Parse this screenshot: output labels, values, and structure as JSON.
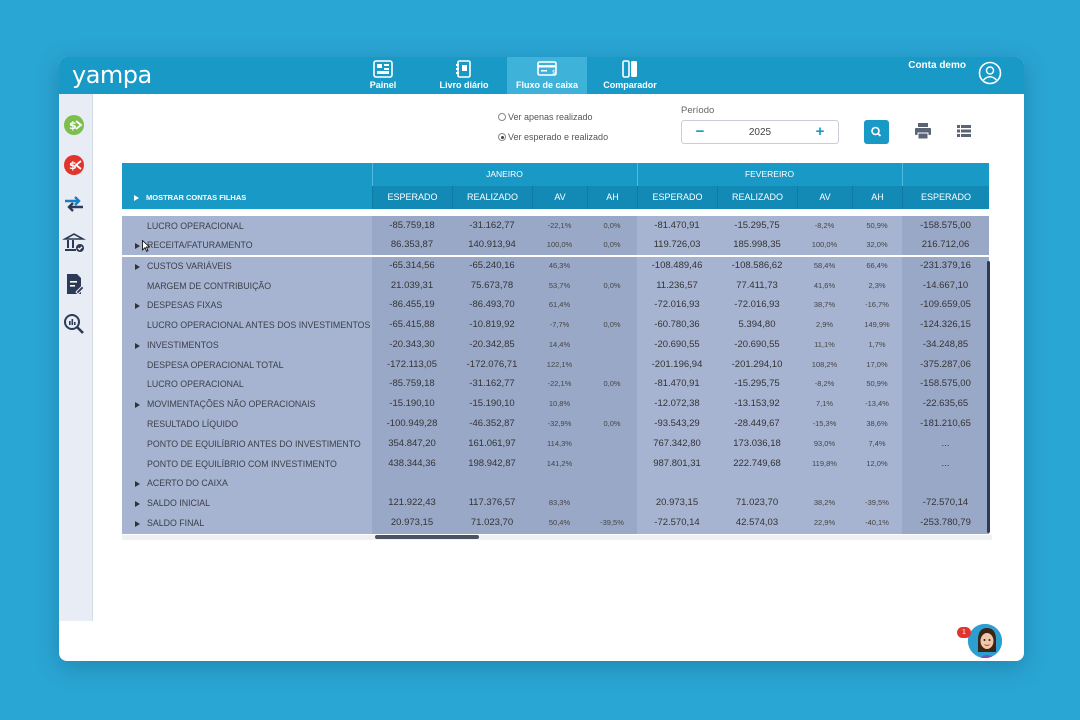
{
  "app": {
    "logo": "yampa",
    "account_label": "Conta demo"
  },
  "nav": {
    "items": [
      {
        "label": "Painel",
        "icon": "dashboard-icon"
      },
      {
        "label": "Livro diário",
        "icon": "journal-icon"
      },
      {
        "label": "Fluxo de caixa",
        "icon": "cashflow-icon",
        "active": true
      },
      {
        "label": "Comparador",
        "icon": "compare-icon"
      }
    ]
  },
  "sidebar": {
    "icons": [
      "income-icon",
      "expense-icon",
      "transfer-icon",
      "bank-check-icon",
      "report-edit-icon",
      "search-analytics-icon"
    ]
  },
  "filters": {
    "radio_realizado": "Ver apenas realizado",
    "radio_esperado": "Ver esperado e realizado",
    "selected": "esperado",
    "periodo_label": "Período",
    "year": "2025",
    "minus": "−",
    "plus": "+"
  },
  "table": {
    "months": [
      "JANEIRO",
      "FEVEREIRO"
    ],
    "show_children_label": "MOSTRAR CONTAS FILHAS",
    "columns": [
      "ESPERADO",
      "REALIZADO",
      "AV",
      "AH",
      "ESPERADO",
      "REALIZADO",
      "AV",
      "AH",
      "ESPERADO"
    ],
    "rows": [
      {
        "label": "LUCRO OPERACIONAL",
        "expand": false,
        "values": [
          "-85.759,18",
          "-31.162,77",
          "-22,1%",
          "0,0%",
          "-81.470,91",
          "-15.295,75",
          "-8,2%",
          "50,9%",
          "-158.575,00"
        ]
      },
      {
        "label": "RECEITA/FATURAMENTO",
        "expand": true,
        "values": [
          "86.353,87",
          "140.913,94",
          "100,0%",
          "0,0%",
          "119.726,03",
          "185.998,35",
          "100,0%",
          "32,0%",
          "216.712,06"
        ]
      },
      {
        "label": "CUSTOS VARIÁVEIS",
        "expand": true,
        "values": [
          "-65.314,56",
          "-65.240,16",
          "46,3%",
          "",
          "-108.489,46",
          "-108.586,62",
          "58,4%",
          "66,4%",
          "-231.379,16"
        ]
      },
      {
        "label": "MARGEM DE CONTRIBUIÇÃO",
        "expand": false,
        "values": [
          "21.039,31",
          "75.673,78",
          "53,7%",
          "0,0%",
          "11.236,57",
          "77.411,73",
          "41,6%",
          "2,3%",
          "-14.667,10"
        ]
      },
      {
        "label": "DESPESAS FIXAS",
        "expand": true,
        "values": [
          "-86.455,19",
          "-86.493,70",
          "61,4%",
          "",
          "-72.016,93",
          "-72.016,93",
          "38,7%",
          "-16,7%",
          "-109.659,05"
        ]
      },
      {
        "label": "LUCRO OPERACIONAL ANTES DOS INVESTIMENTOS",
        "expand": false,
        "values": [
          "-65.415,88",
          "-10.819,92",
          "-7,7%",
          "0,0%",
          "-60.780,36",
          "5.394,80",
          "2,9%",
          "149,9%",
          "-124.326,15"
        ]
      },
      {
        "label": "INVESTIMENTOS",
        "expand": true,
        "values": [
          "-20.343,30",
          "-20.342,85",
          "14,4%",
          "",
          "-20.690,55",
          "-20.690,55",
          "11,1%",
          "1,7%",
          "-34.248,85"
        ]
      },
      {
        "label": "DESPESA OPERACIONAL TOTAL",
        "expand": false,
        "values": [
          "-172.113,05",
          "-172.076,71",
          "122,1%",
          "",
          "-201.196,94",
          "-201.294,10",
          "108,2%",
          "17,0%",
          "-375.287,06"
        ]
      },
      {
        "label": "LUCRO OPERACIONAL",
        "expand": false,
        "values": [
          "-85.759,18",
          "-31.162,77",
          "-22,1%",
          "0,0%",
          "-81.470,91",
          "-15.295,75",
          "-8,2%",
          "50,9%",
          "-158.575,00"
        ]
      },
      {
        "label": "MOVIMENTAÇÕES NÃO OPERACIONAIS",
        "expand": true,
        "values": [
          "-15.190,10",
          "-15.190,10",
          "10,8%",
          "",
          "-12.072,38",
          "-13.153,92",
          "7,1%",
          "-13,4%",
          "-22.635,65"
        ]
      },
      {
        "label": "RESULTADO LÍQUIDO",
        "expand": false,
        "values": [
          "-100.949,28",
          "-46.352,87",
          "-32,9%",
          "0,0%",
          "-93.543,29",
          "-28.449,67",
          "-15,3%",
          "38,6%",
          "-181.210,65"
        ]
      },
      {
        "label": "PONTO DE EQUILÍBRIO ANTES DO INVESTIMENTO",
        "expand": false,
        "values": [
          "354.847,20",
          "161.061,97",
          "114,3%",
          "",
          "767.342,80",
          "173.036,18",
          "93,0%",
          "7,4%",
          "..."
        ]
      },
      {
        "label": "PONTO DE EQUILÍBRIO COM INVESTIMENTO",
        "expand": false,
        "values": [
          "438.344,36",
          "198.942,87",
          "141,2%",
          "",
          "987.801,31",
          "222.749,68",
          "119,8%",
          "12,0%",
          "..."
        ]
      },
      {
        "label": "ACERTO DO CAIXA",
        "expand": true,
        "values": [
          "",
          "",
          "",
          "",
          "",
          "",
          "",
          "",
          ""
        ]
      },
      {
        "label": "SALDO INICIAL",
        "expand": true,
        "values": [
          "121.922,43",
          "117.376,57",
          "83,3%",
          "",
          "20.973,15",
          "71.023,70",
          "38,2%",
          "-39,5%",
          "-72.570,14"
        ]
      },
      {
        "label": "SALDO FINAL",
        "expand": true,
        "values": [
          "20.973,15",
          "71.023,70",
          "50,4%",
          "-39,5%",
          "-72.570,14",
          "42.574,03",
          "22,9%",
          "-40,1%",
          "-253.780,79"
        ]
      }
    ]
  },
  "assistant": {
    "badge": "1"
  },
  "colors": {
    "brand": "#1899c6",
    "background": "#2aa6d4",
    "row_light": "#a7b4d1",
    "row_dark": "#9aa8c7"
  }
}
